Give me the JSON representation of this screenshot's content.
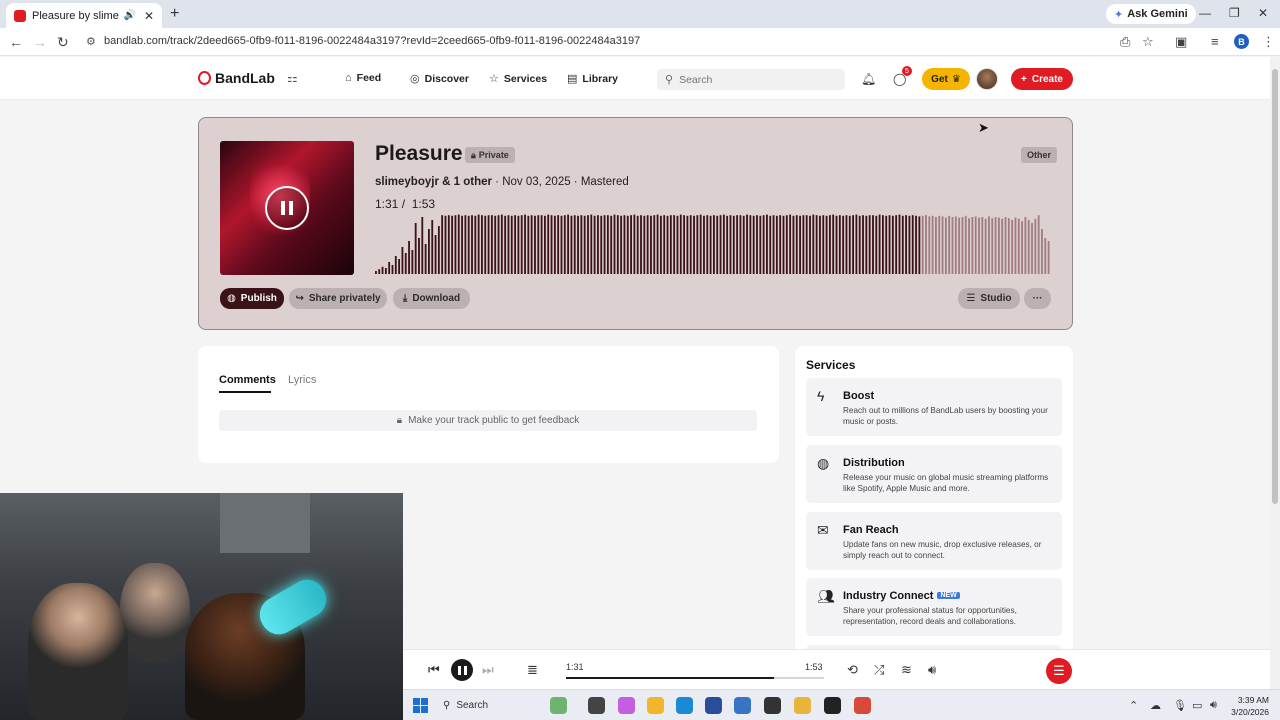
{
  "browser": {
    "tab_title": "Pleasure by slimeyboyjr | BandLab",
    "url": "bandlab.com/track/2deed665-0fb9-f011-8196-0022484a3197?revId=2ceed665-0fb9-f011-8196-0022484a3197",
    "gemini_label": "Ask Gemini",
    "profile_initial": "B"
  },
  "header": {
    "logo": "BandLab",
    "nav": {
      "feed": "Feed",
      "discover": "Discover",
      "services": "Services",
      "library": "Library"
    },
    "search_placeholder": "Search",
    "notification_badge": "5",
    "get_label": "Get",
    "create_label": "Create"
  },
  "track": {
    "title": "Pleasure",
    "privacy": "Private",
    "genre": "Other",
    "artist": "slimeyboyjr",
    "collaborators": "& 1 other",
    "date_status": "· Nov 03, 2025 · Mastered",
    "current_time": "1:31",
    "duration": "1:53",
    "progress_fraction": 0.805,
    "waveform_amplitudes": [
      0.05,
      0.08,
      0.12,
      0.1,
      0.2,
      0.15,
      0.3,
      0.25,
      0.45,
      0.35,
      0.55,
      0.4,
      0.85,
      0.6,
      0.95,
      0.5,
      0.75,
      0.9,
      0.65,
      0.8,
      0.98,
      0.97,
      0.98,
      0.97,
      0.98,
      0.99,
      0.97,
      0.98,
      0.97,
      0.98,
      0.97,
      0.99,
      0.98,
      0.97,
      0.98,
      0.98,
      0.97,
      0.98,
      0.99,
      0.97,
      0.98,
      0.97,
      0.98,
      0.97,
      0.98,
      0.99,
      0.97,
      0.98,
      0.97,
      0.98,
      0.98,
      0.97,
      0.99,
      0.98,
      0.97,
      0.98,
      0.97,
      0.98,
      0.99,
      0.97,
      0.98,
      0.97,
      0.98,
      0.97,
      0.98,
      0.99,
      0.97,
      0.98,
      0.97,
      0.98,
      0.98,
      0.97,
      0.99,
      0.98,
      0.97,
      0.98,
      0.97,
      0.98,
      0.99,
      0.97,
      0.98,
      0.97,
      0.98,
      0.97,
      0.98,
      0.99,
      0.97,
      0.98,
      0.97,
      0.98,
      0.98,
      0.97,
      0.99,
      0.98,
      0.97,
      0.98,
      0.97,
      0.98,
      0.99,
      0.97,
      0.98,
      0.97,
      0.98,
      0.97,
      0.98,
      0.99,
      0.97,
      0.98,
      0.97,
      0.98,
      0.98,
      0.97,
      0.99,
      0.98,
      0.97,
      0.98,
      0.97,
      0.98,
      0.99,
      0.97,
      0.98,
      0.97,
      0.98,
      0.97,
      0.98,
      0.99,
      0.97,
      0.98,
      0.97,
      0.98,
      0.98,
      0.97,
      0.99,
      0.98,
      0.97,
      0.98,
      0.97,
      0.98,
      0.99,
      0.97,
      0.98,
      0.97,
      0.98,
      0.97,
      0.98,
      0.99,
      0.97,
      0.98,
      0.97,
      0.98,
      0.98,
      0.97,
      0.99,
      0.98,
      0.97,
      0.98,
      0.97,
      0.98,
      0.99,
      0.97,
      0.98,
      0.97,
      0.98,
      0.97,
      0.96,
      0.97,
      0.98,
      0.96,
      0.97,
      0.95,
      0.97,
      0.96,
      0.94,
      0.97,
      0.95,
      0.96,
      0.94,
      0.95,
      0.97,
      0.93,
      0.95,
      0.96,
      0.94,
      0.95,
      0.92,
      0.96,
      0.93,
      0.95,
      0.94,
      0.92,
      0.95,
      0.93,
      0.9,
      0.94,
      0.92,
      0.88,
      0.95,
      0.9,
      0.85,
      0.92,
      0.98,
      0.75,
      0.6,
      0.55
    ]
  },
  "actions": {
    "publish": "Publish",
    "share": "Share privately",
    "download": "Download",
    "studio": "Studio",
    "more": "···"
  },
  "comments": {
    "tabs": [
      "Comments",
      "Lyrics"
    ],
    "feedback": "Make your track public to get feedback"
  },
  "services": {
    "title": "Services",
    "items": [
      {
        "name": "Boost",
        "desc": "Reach out to millions of BandLab users by boosting your music or posts.",
        "icon": "lightning-icon"
      },
      {
        "name": "Distribution",
        "desc": "Release your music on global music streaming platforms like Spotify, Apple Music and more.",
        "icon": "globe-icon"
      },
      {
        "name": "Fan Reach",
        "desc": "Update fans on new music, drop exclusive releases, or simply reach out to connect.",
        "icon": "mail-icon"
      },
      {
        "name": "Industry Connect",
        "desc": "Share your professional status for opportunities, representation, record deals and collaborations.",
        "icon": "people-icon",
        "badge": "NEW"
      }
    ]
  },
  "player": {
    "current": "1:31",
    "duration": "1:53",
    "progress_fraction": 0.805
  },
  "taskbar": {
    "search_label": "Search",
    "time": "3:39 AM",
    "date": "3/20/2026"
  },
  "colors": {
    "accent": "#e01b24",
    "card_bg": "#ddd0d1",
    "wave_played": "#3a1218",
    "wave_unplayed": "#a07c80"
  }
}
